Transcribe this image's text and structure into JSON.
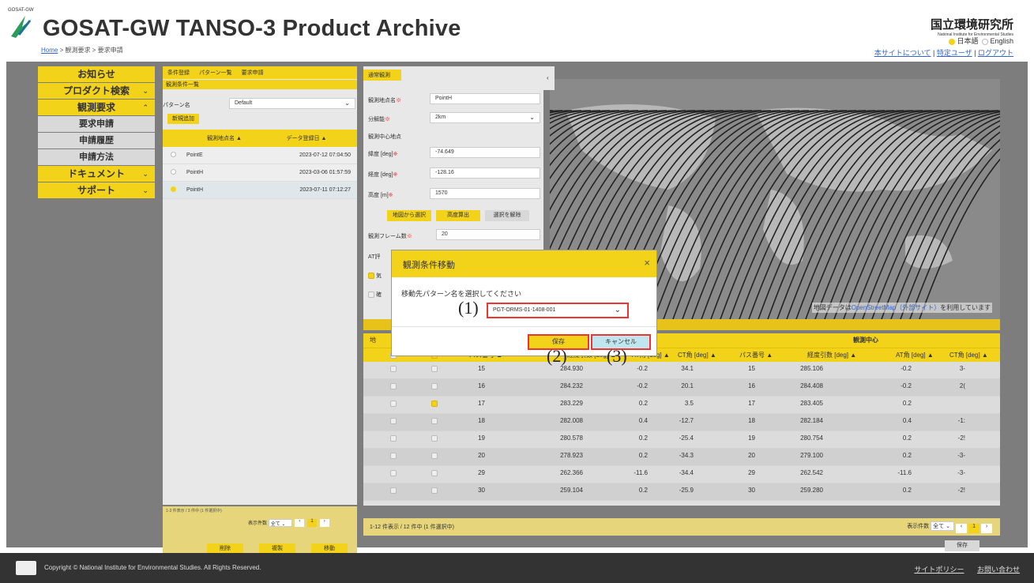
{
  "header": {
    "logo_small": "GOSAT-GW",
    "title": "GOSAT-GW TANSO-3 Product Archive",
    "breadcrumb": {
      "home": "Home",
      "rest": " > 観測要求 > 要求申請"
    },
    "org_name": "国立環境研究所",
    "org_en": "National Institute for Environmental Studies",
    "lang": {
      "ja": "日本語",
      "en": "English"
    },
    "links": {
      "about": "本サイトについて",
      "user": "特定ユーザ",
      "logout": "ログアウト",
      "sep": " | "
    }
  },
  "nav": [
    {
      "label": "お知らせ",
      "chev": ""
    },
    {
      "label": "プロダクト検索",
      "chev": "⌄"
    },
    {
      "label": "観測要求",
      "chev": "⌃"
    },
    {
      "label": "要求申請",
      "sub": true
    },
    {
      "label": "申請履歴",
      "sub": true
    },
    {
      "label": "申請方法",
      "sub": true
    },
    {
      "label": "ドキュメント",
      "chev": "⌄"
    },
    {
      "label": "サポート",
      "chev": "⌄"
    }
  ],
  "mid": {
    "tabs": [
      "条件登録",
      "パターン一覧",
      "要求申請"
    ],
    "section": "観測条件一覧",
    "pattern_label": "パターン名",
    "pattern_value": "Default",
    "new_button": "新規追加",
    "col_name": "観測地点名",
    "col_date": "データ登録日",
    "rows": [
      {
        "name": "PointE",
        "date": "2023-07-12 07:04:50",
        "sel": false
      },
      {
        "name": "PointH",
        "date": "2023-03-06 01:57:59",
        "sel": false
      },
      {
        "name": "PointH",
        "date": "2023-07-11 07:12:27",
        "sel": true
      }
    ],
    "count": "1-3 件表示 / 3 件中 (1 件選択中)",
    "per_page_label": "表示件数",
    "per_page": "全て",
    "page": "1",
    "prev": "«",
    "prev1": "‹",
    "next1": "›",
    "next": "»",
    "buttons": [
      "削除",
      "複製",
      "移動"
    ]
  },
  "form": {
    "tab": "通常観測",
    "name_label": "観測地点名",
    "name_value": "PointH",
    "res_label": "分解能",
    "res_value": "2km",
    "center_label": "観測中心地点",
    "lat_label": "緯度 [deg]",
    "lat_value": "-74.649",
    "lon_label": "経度 [deg]",
    "lon_value": "-128.16",
    "alt_label": "高度 [m]",
    "alt_value": "1570",
    "btn_map": "地図から選択",
    "btn_alt": "高度算出",
    "btn_clear": "選択を解除",
    "frames_label": "観測フレーム数",
    "frames_value": "20",
    "at_label": "AT評",
    "chk1_label": "気",
    "chk2_label": "確",
    "req_mark": "※"
  },
  "map": {
    "credit_pre": "地図データは",
    "credit_link": "OpenStreetMap（外部サイト）",
    "credit_post": "を利用しています"
  },
  "table": {
    "group_left": "地",
    "group_center": "観測中心",
    "headers": [
      "パス番号",
      "経度引数 [deg]",
      "AT角 [deg]",
      "CT角 [deg]",
      "パス番号",
      "経度引数 [deg]",
      "AT角 [deg]",
      "CT角 [deg]"
    ],
    "sort_mark": "▲",
    "rows": [
      {
        "p": "15",
        "lon": "284.930",
        "at": "-0.2",
        "ct": "34.1",
        "p2": "15",
        "lon2": "285.106",
        "at2": "-0.2",
        "ct2": "3-",
        "c2": false
      },
      {
        "p": "16",
        "lon": "284.232",
        "at": "-0.2",
        "ct": "20.1",
        "p2": "16",
        "lon2": "284.408",
        "at2": "-0.2",
        "ct2": "2(",
        "c2": false
      },
      {
        "p": "17",
        "lon": "283.229",
        "at": "0.2",
        "ct": "3.5",
        "p2": "17",
        "lon2": "283.405",
        "at2": "0.2",
        "ct2": "",
        "c2": true
      },
      {
        "p": "18",
        "lon": "282.008",
        "at": "0.4",
        "ct": "-12.7",
        "p2": "18",
        "lon2": "282.184",
        "at2": "0.4",
        "ct2": "-1:",
        "c2": false
      },
      {
        "p": "19",
        "lon": "280.578",
        "at": "0.2",
        "ct": "-25.4",
        "p2": "19",
        "lon2": "280.754",
        "at2": "0.2",
        "ct2": "-2!",
        "c2": false
      },
      {
        "p": "20",
        "lon": "278.923",
        "at": "0.2",
        "ct": "-34.3",
        "p2": "20",
        "lon2": "279.100",
        "at2": "0.2",
        "ct2": "-3-",
        "c2": false
      },
      {
        "p": "29",
        "lon": "262.366",
        "at": "-11.6",
        "ct": "-34.4",
        "p2": "29",
        "lon2": "262.542",
        "at2": "-11.6",
        "ct2": "-3-",
        "c2": false
      },
      {
        "p": "30",
        "lon": "259.104",
        "at": "0.2",
        "ct": "-25.9",
        "p2": "30",
        "lon2": "259.280",
        "at2": "0.2",
        "ct2": "-2!",
        "c2": false
      }
    ],
    "count": "1-12 件表示 / 12 件中 (1 件選択中)",
    "per_page_label": "表示件数",
    "per_page": "全て",
    "page": "1",
    "save": "保存"
  },
  "modal": {
    "title": "観測条件移動",
    "close": "×",
    "label": "移動先パターン名を選択してください",
    "select_value": "PGT-ORMS-01-1408-001",
    "save": "保存",
    "cancel": "キャンセル",
    "n1": "(1)",
    "n2": "(2)",
    "n3": "(3)"
  },
  "footer": {
    "copyright": "Copyright © National Institute for Environmental Studies. All Rights Reserved.",
    "policy": "サイトポリシー",
    "contact": "お問い合わせ"
  },
  "colors": {
    "accent": "#f3d21a",
    "highlight": "#e33333",
    "footer": "#333333"
  }
}
